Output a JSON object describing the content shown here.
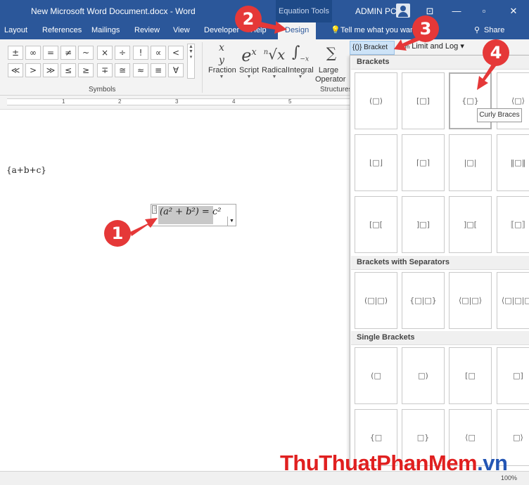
{
  "titlebar": {
    "doc_title": "New Microsoft Word Document.docx - Word",
    "context_tab": "Equation Tools",
    "user": "ADMIN PC"
  },
  "tabs": {
    "layout": "Layout",
    "references": "References",
    "mailings": "Mailings",
    "review": "Review",
    "view": "View",
    "developer": "Developer",
    "help": "Help",
    "design": "Design",
    "tell_me": "Tell me what you want to do",
    "share": "Share"
  },
  "symbols": {
    "row1": [
      "±",
      "∞",
      "=",
      "≠",
      "~",
      "×",
      "÷",
      "!",
      "∝",
      "<"
    ],
    "row2": [
      "≪",
      ">",
      "≫",
      "≤",
      "≥",
      "∓",
      "≅",
      "≈",
      "≡",
      "∀"
    ],
    "group_label": "Symbols"
  },
  "structures": {
    "fraction": "Fraction",
    "script": "Script",
    "radical": "Radical",
    "integral": "Integral",
    "large_operator": "Large Operator",
    "group_label": "Structures",
    "bracket": "{()} Bracket",
    "limit_log": "Limit and Log"
  },
  "ruler": {
    "numbers": [
      "1",
      "2",
      "3",
      "4",
      "5"
    ]
  },
  "document": {
    "text_line": "{a+b+c}",
    "equation": "(a² + b²) = c²"
  },
  "gallery": {
    "sections": {
      "brackets": "Brackets",
      "with_separators": "Brackets with Separators",
      "single": "Single Brackets"
    },
    "brackets_row1": [
      "(□)",
      "[□]",
      "{□}",
      "⟨□⟩"
    ],
    "brackets_row2": [
      "⌊□⌋",
      "⌈□⌉",
      "|□|",
      "‖□‖"
    ],
    "brackets_row3": [
      "[□[",
      "]□]",
      "]□[",
      "⟦□⟧"
    ],
    "separators_row": [
      "(□|□)",
      "{□|□}",
      "⟨□|□⟩",
      "⟨□|□|□⟩"
    ],
    "single_row1": [
      "(□",
      "□)",
      "[□",
      "□]"
    ],
    "single_row2": [
      "{□",
      "□}",
      "⟨□",
      "□⟩"
    ],
    "tooltip": "Curly Braces"
  },
  "status": {
    "zoom": "100%"
  },
  "callouts": [
    "1",
    "2",
    "3",
    "4"
  ],
  "watermark": {
    "main": "ThuThuatPhanMem",
    "tld": ".vn"
  },
  "colors": {
    "title_blue": "#2b579a",
    "callout_red": "#e53838"
  }
}
